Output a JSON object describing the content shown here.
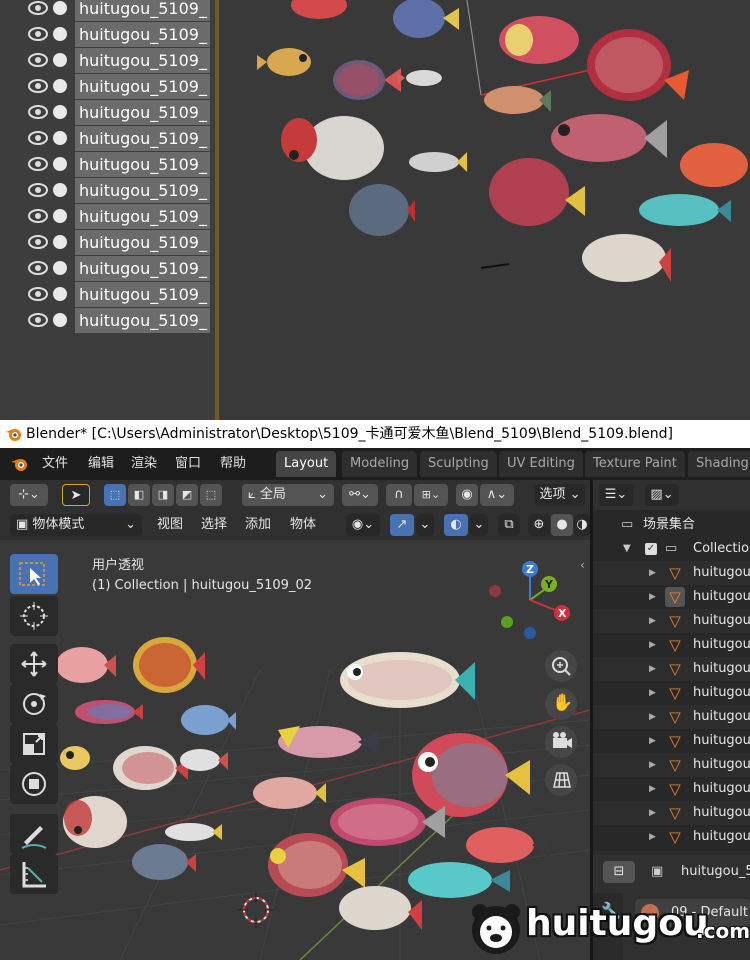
{
  "top_outliner": {
    "rows": [
      "huitugou_5109_",
      "huitugou_5109_",
      "huitugou_5109_",
      "huitugou_5109_",
      "huitugou_5109_",
      "huitugou_5109_",
      "huitugou_5109_",
      "huitugou_5109_",
      "huitugou_5109_",
      "huitugou_5109_",
      "huitugou_5109_",
      "huitugou_5109_",
      "huitugou_5109_"
    ]
  },
  "title_bar": {
    "text": "Blender* [C:\\Users\\Administrator\\Desktop\\5109_卡通可爱木鱼\\Blend_5109\\Blend_5109.blend]"
  },
  "menu": {
    "items": [
      "文件",
      "编辑",
      "渲染",
      "窗口",
      "帮助"
    ]
  },
  "workspaces": {
    "tabs": [
      "Layout",
      "Modeling",
      "Sculpting",
      "UV Editing",
      "Texture Paint",
      "Shading"
    ],
    "active": "Layout"
  },
  "header1": {
    "orientation": "全局",
    "options": "选项"
  },
  "header2": {
    "mode": "物体模式",
    "view": "视图",
    "select": "选择",
    "add": "添加",
    "object": "物体"
  },
  "viewport": {
    "view_name": "用户透视",
    "collection_info": "(1) Collection | huitugou_5109_02"
  },
  "gizmo": {
    "z": "Z",
    "y": "Y",
    "x": "X"
  },
  "right_outliner": {
    "scene_collection": "场景集合",
    "collection": "Collection",
    "items": [
      "huitugou_",
      "huitugou_",
      "huitugou_",
      "huitugou_",
      "huitugou_",
      "huitugou_",
      "huitugou_",
      "huitugou_",
      "huitugou_",
      "huitugou_",
      "huitugou_",
      "huitugou_"
    ]
  },
  "properties": {
    "object_name": "huitugou_5",
    "material": "09 - Default"
  },
  "watermark": {
    "main": "huitugou",
    "suffix": ".com"
  },
  "colors": {
    "accent_blue": "#4772b3",
    "menubar": "#1d1d1d",
    "header": "#303030",
    "orange_mesh": "#e8873a"
  }
}
